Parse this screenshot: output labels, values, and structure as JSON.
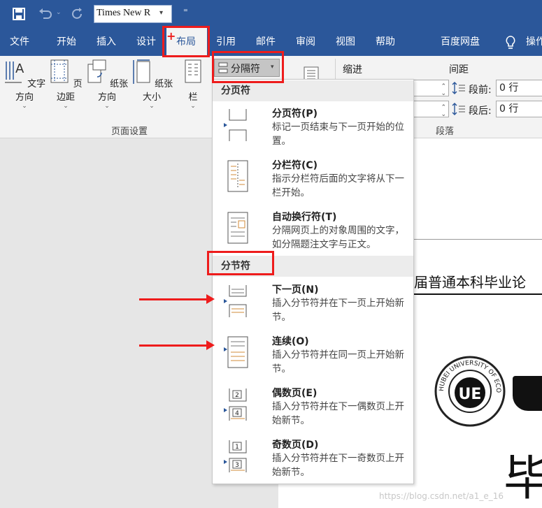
{
  "qat": {
    "font_name": "Times New R",
    "customize": "⁼"
  },
  "tabs": [
    {
      "label": "文件"
    },
    {
      "label": "开始"
    },
    {
      "label": "插入"
    },
    {
      "label": "设计"
    },
    {
      "label": "布局"
    },
    {
      "label": "引用"
    },
    {
      "label": "邮件"
    },
    {
      "label": "审阅"
    },
    {
      "label": "视图"
    },
    {
      "label": "帮助"
    },
    {
      "label": "百度网盘"
    },
    {
      "label": "操作"
    }
  ],
  "ribbon": {
    "buttons": [
      {
        "label": "文字方向"
      },
      {
        "label": "页边距"
      },
      {
        "label": "纸张方向"
      },
      {
        "label": "纸张大小"
      },
      {
        "label": "栏"
      }
    ],
    "breaks_button": "分隔符",
    "page_setup_group": "页面设置",
    "indent_label": "缩进",
    "spacing_label": "间距",
    "before_label": "段前:",
    "before_value": "0 行",
    "after_label": "段后:",
    "after_value": "0 行",
    "paragraph_group": "段落"
  },
  "menu": {
    "page_breaks_header": "分页符",
    "section_breaks_header": "分节符",
    "items": [
      {
        "title": "分页符(P)",
        "desc": "标记一页结束与下一页开始的位置。"
      },
      {
        "title": "分栏符(C)",
        "desc": "指示分栏符后面的文字将从下一栏开始。"
      },
      {
        "title": "自动换行符(T)",
        "desc": "分隔网页上的对象周围的文字，如分隔题注文字与正文。"
      },
      {
        "title": "下一页(N)",
        "desc": "插入分节符并在下一页上开始新节。"
      },
      {
        "title": "连续(O)",
        "desc": "插入分节符并在同一页上开始新节。"
      },
      {
        "title": "偶数页(E)",
        "desc": "插入分节符并在下一偶数页上开始新节。"
      },
      {
        "title": "奇数页(D)",
        "desc": "插入分节符并在下一奇数页上开始新节。"
      }
    ]
  },
  "document": {
    "heading": "届普通本科毕业论",
    "seal_text": "HUBEI UNIVERSITY OF ECONOMICS",
    "seal_letters": "UE",
    "big_char": "毕"
  },
  "watermark": "https://blog.csdn.net/a1_e_16"
}
